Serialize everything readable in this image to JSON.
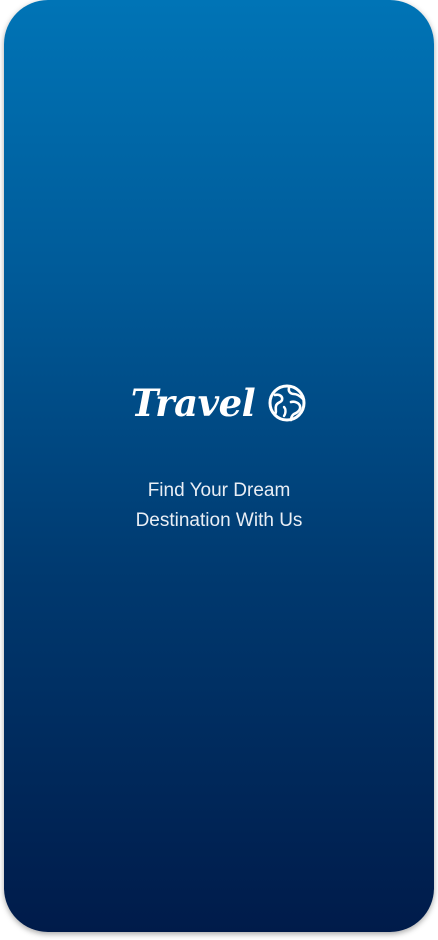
{
  "splash": {
    "logo_text": "Travel",
    "logo_icon": "globe-icon",
    "tagline_line1": "Find Your Dream",
    "tagline_line2": "Destination With Us"
  },
  "colors": {
    "gradient_top": "#0074b6",
    "gradient_bottom": "#001b4a",
    "text": "#ffffff"
  }
}
